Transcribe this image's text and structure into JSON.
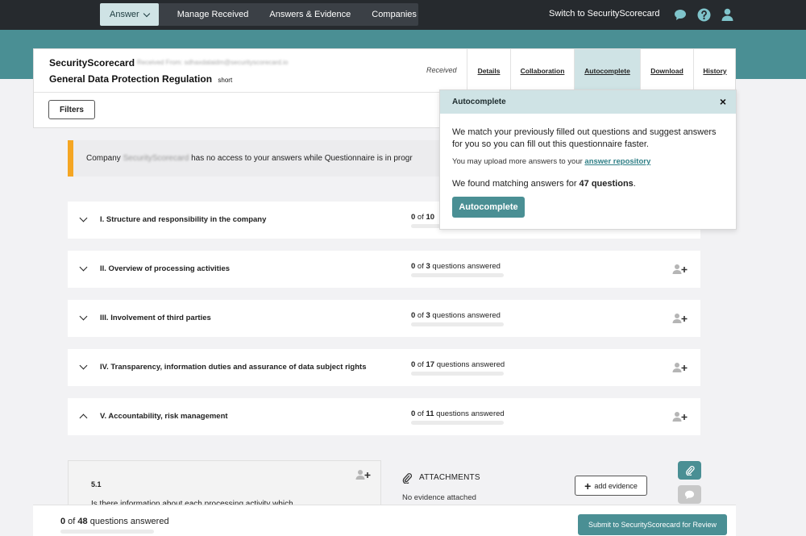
{
  "nav": {
    "answer_label": "Answer",
    "items": [
      "Manage Received",
      "Answers & Evidence",
      "Companies"
    ],
    "switch_label": "Switch to SecurityScorecard"
  },
  "header": {
    "company": "SecurityScorecard",
    "received_from": "Received From: sdhaxdalaidm@securityscorecard.io",
    "questionnaire": "General Data Protection Regulation",
    "size": "short",
    "status": "Received",
    "tabs": [
      "Details",
      "Collaboration",
      "Autocomplete",
      "Download",
      "History"
    ],
    "active_tab": "Autocomplete",
    "filters_label": "Filters"
  },
  "notice": {
    "prefix": "Company",
    "company": "SecurityScorecard",
    "suffix": "has no access to your answers while Questionnaire is in progr"
  },
  "sections": [
    {
      "title": "I. Structure and responsibility in the company",
      "answered": "0",
      "of": " of ",
      "total": "10",
      "suffix": ""
    },
    {
      "title": "II. Overview of processing activities",
      "answered": "0",
      "of": " of ",
      "total": "3",
      "suffix": " questions answered"
    },
    {
      "title": "III. Involvement of third parties",
      "answered": "0",
      "of": " of ",
      "total": "3",
      "suffix": " questions answered"
    },
    {
      "title": "IV. Transparency, information duties and assurance of data subject rights",
      "answered": "0",
      "of": " of ",
      "total": "17",
      "suffix": " questions answered"
    },
    {
      "title": "V. Accountability, risk management",
      "answered": "0",
      "of": " of ",
      "total": "11",
      "suffix": " questions answered"
    }
  ],
  "question": {
    "number": "5.1",
    "text": "Is there information about each processing activity which"
  },
  "attachments": {
    "title": "ATTACHMENTS",
    "empty": "No evidence attached",
    "add_label": "add evidence"
  },
  "footer": {
    "answered": "0",
    "of": " of ",
    "total": "48",
    "suffix": " questions answered",
    "submit_label": "Submit to SecurityScorecard for Review"
  },
  "autocomplete": {
    "title": "Autocomplete",
    "close": "×",
    "description": "We match your previously filled out questions and suggest answers for you so you can fill out this questionnaire faster.",
    "upload_prefix": "You may upload more answers to your ",
    "upload_link": "answer repository",
    "found_prefix": "We found matching answers for ",
    "found_count": "47 questions",
    "found_suffix": ".",
    "button_label": "Autocomplete"
  },
  "colors": {
    "accent": "#4a8f94",
    "accent_light": "#cfe3e5",
    "nav_bg": "#262a2e",
    "notice_border": "#f5a623"
  }
}
